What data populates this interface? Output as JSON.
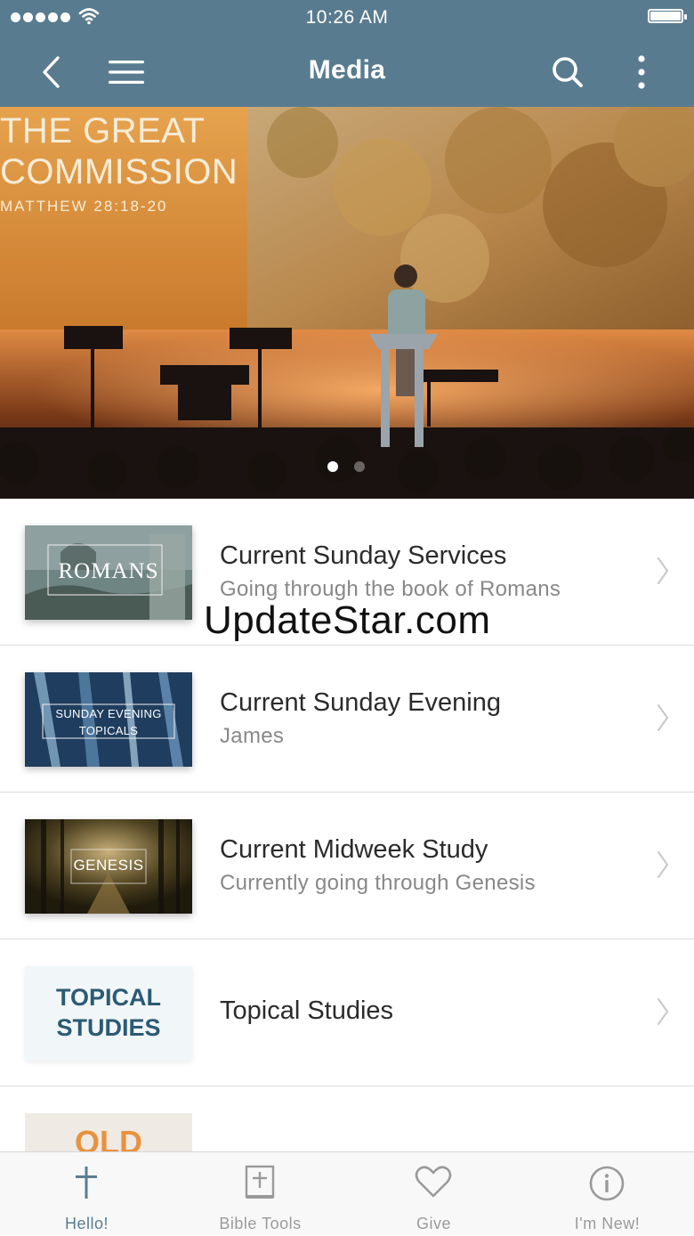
{
  "status_bar": {
    "time": "10:26 AM"
  },
  "nav": {
    "title": "Media",
    "back_icon": "chevron-left-icon",
    "menu_icon": "hamburger-menu-icon",
    "search_icon": "search-icon",
    "more_icon": "vertical-dots-icon"
  },
  "hero": {
    "line1": "THE GREAT",
    "line2": "COMMISSION",
    "line3": "MATTHEW 28:18-20",
    "slide_count": 2,
    "active_slide": 1
  },
  "watermark": "UpdateStar.com",
  "items": [
    {
      "title": "Current Sunday Services",
      "subtitle": "Going through the book of Romans",
      "thumb_text": "ROMANS"
    },
    {
      "title": "Current Sunday Evening",
      "subtitle": "James",
      "thumb_text_1": "SUNDAY EVENING",
      "thumb_text_2": "TOPICALS"
    },
    {
      "title": "Current Midweek Study",
      "subtitle": "Currently going through Genesis",
      "thumb_text": "GENESIS"
    },
    {
      "title": "Topical Studies",
      "thumb_text_1": "TOPICAL",
      "thumb_text_2": "STUDIES"
    },
    {
      "thumb_text": "OLD"
    }
  ],
  "tabs": [
    {
      "label": "Hello!",
      "icon": "cross-icon",
      "active": true
    },
    {
      "label": "Bible Tools",
      "icon": "bible-icon",
      "active": false
    },
    {
      "label": "Give",
      "icon": "heart-icon",
      "active": false
    },
    {
      "label": "I'm New!",
      "icon": "info-icon",
      "active": false
    }
  ],
  "colors": {
    "nav_bar": "#597b8f",
    "tab_active": "#5a7d91",
    "tab_inactive": "#9a9a9a",
    "topical_text": "#2c5a73"
  }
}
